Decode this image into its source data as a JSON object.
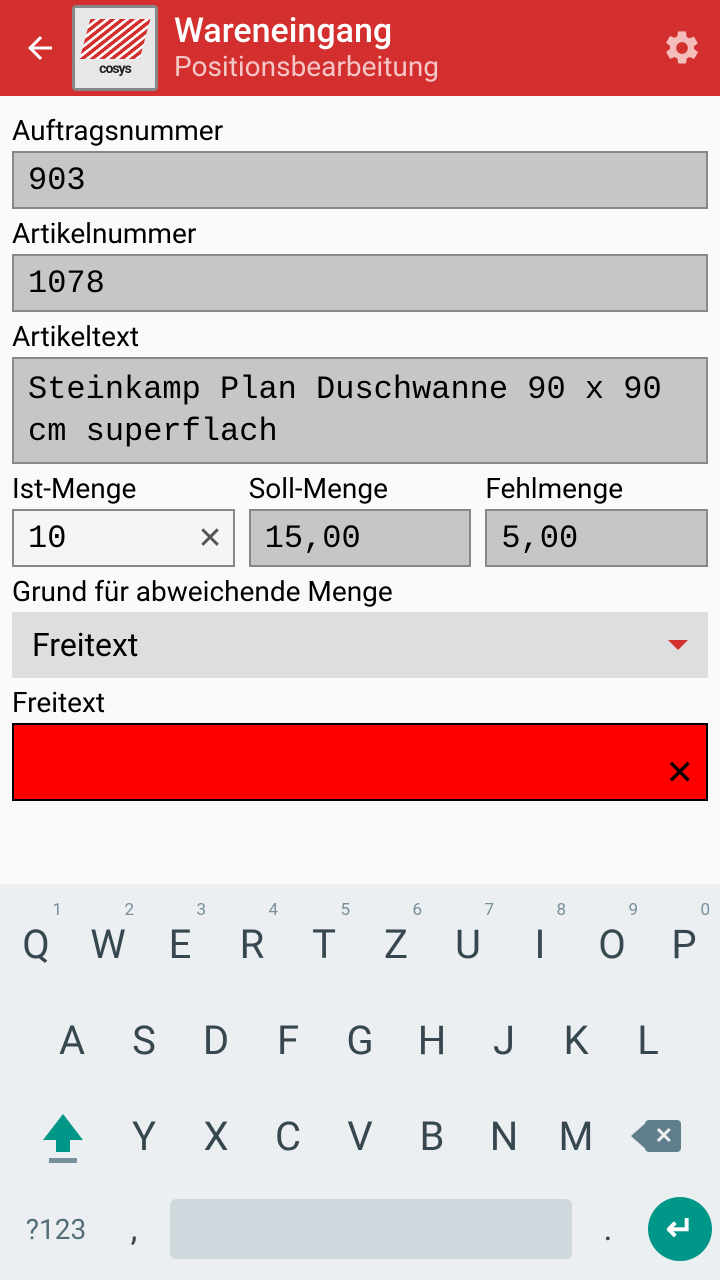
{
  "header": {
    "title": "Wareneingang",
    "subtitle": "Positionsbearbeitung",
    "logo_text": "cosys"
  },
  "fields": {
    "auftragsnummer": {
      "label": "Auftragsnummer",
      "value": "903"
    },
    "artikelnummer": {
      "label": "Artikelnummer",
      "value": "1078"
    },
    "artikeltext": {
      "label": "Artikeltext",
      "value": "Steinkamp Plan Duschwanne 90 x 90 cm superflach"
    },
    "ist_menge": {
      "label": "Ist-Menge",
      "value": "10"
    },
    "soll_menge": {
      "label": "Soll-Menge",
      "value": "15,00"
    },
    "fehlmenge": {
      "label": "Fehlmenge",
      "value": "5,00"
    },
    "grund": {
      "label": "Grund für abweichende Menge",
      "value": "Freitext"
    },
    "freitext": {
      "label": "Freitext",
      "value": ""
    }
  },
  "keyboard": {
    "row1": [
      "Q",
      "W",
      "E",
      "R",
      "T",
      "Z",
      "U",
      "I",
      "O",
      "P"
    ],
    "row1_nums": [
      "1",
      "2",
      "3",
      "4",
      "5",
      "6",
      "7",
      "8",
      "9",
      "0"
    ],
    "row2": [
      "A",
      "S",
      "D",
      "F",
      "G",
      "H",
      "J",
      "K",
      "L"
    ],
    "row3": [
      "Y",
      "X",
      "C",
      "V",
      "B",
      "N",
      "M"
    ],
    "sym": "?123",
    "comma": ",",
    "dot": "."
  }
}
